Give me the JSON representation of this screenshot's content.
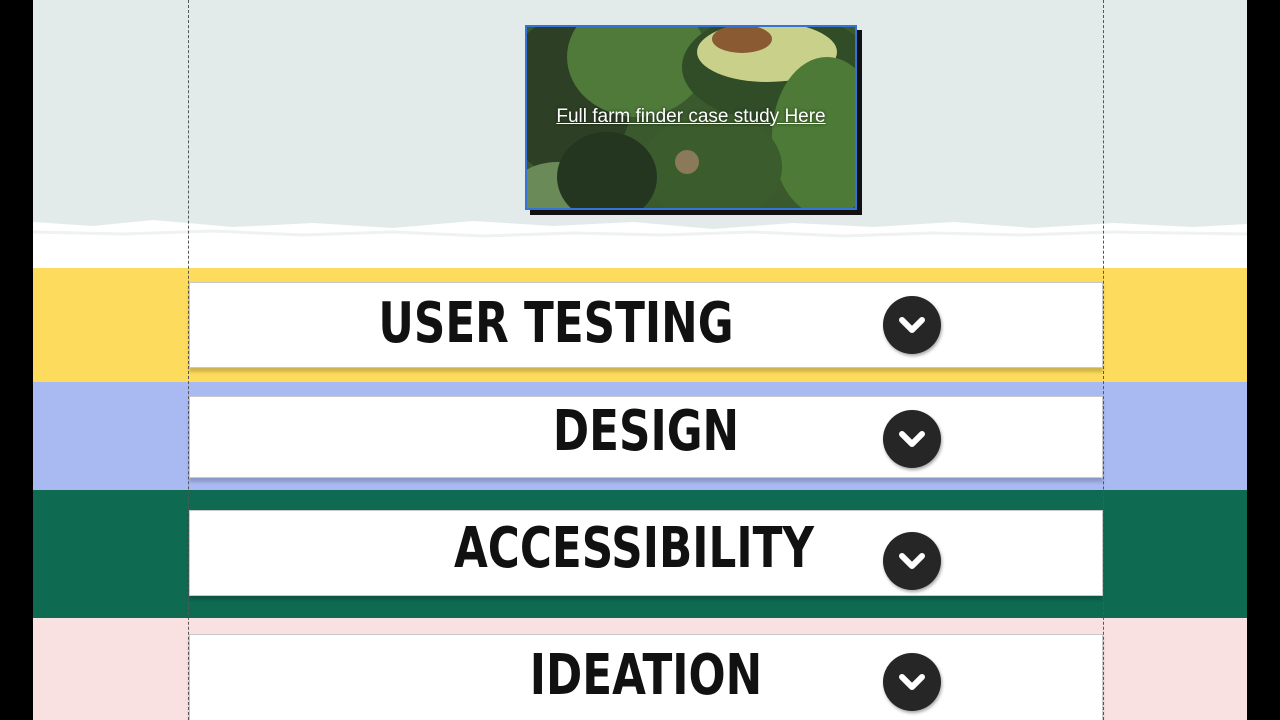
{
  "hero": {
    "link_text": "Full farm finder case study Here",
    "accent_border": "#3573d6",
    "background": "#e3ebea"
  },
  "sections": [
    {
      "title": "USER TESTING",
      "band_color": "#fddb5c",
      "icon": "chevron-down-icon"
    },
    {
      "title": "DESIGN",
      "band_color": "#a9b9f2",
      "icon": "chevron-down-icon"
    },
    {
      "title": "ACCESSIBILITY",
      "band_color": "#0e6b52",
      "icon": "chevron-down-icon"
    },
    {
      "title": "IDEATION",
      "band_color": "#f9e1e1",
      "icon": "chevron-down-icon"
    }
  ]
}
